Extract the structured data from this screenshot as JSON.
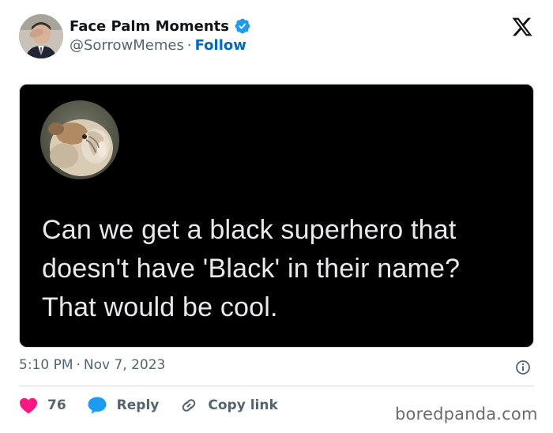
{
  "tweet": {
    "author": {
      "display_name": "Face Palm Moments",
      "handle": "@SorrowMemes",
      "separator": "·",
      "follow_label": "Follow",
      "verified": true
    },
    "media_post": {
      "text_lines": [
        "Can we get a black superhero that",
        "doesn't have 'Black' in their name?",
        "That would be cool."
      ]
    },
    "time": "5:10 PM",
    "date_separator": "·",
    "date": "Nov 7, 2023",
    "actions": {
      "likes_count": "76",
      "reply_label": "Reply",
      "copy_link_label": "Copy link"
    }
  },
  "watermark": "boredpanda.com",
  "icons": {
    "brand": "x-logo-icon",
    "verified": "verified-badge-icon",
    "info": "info-icon",
    "like": "heart-icon",
    "reply": "reply-bubble-icon",
    "copy_link": "link-icon"
  },
  "colors": {
    "verified_blue": "#1d9bf0",
    "follow_link": "#0069c2",
    "like_heart": "#f91880",
    "reply_bubble": "#1d9bf0",
    "secondary_text": "#536471",
    "media_background": "#000000",
    "media_text": "#e7e9ea"
  }
}
